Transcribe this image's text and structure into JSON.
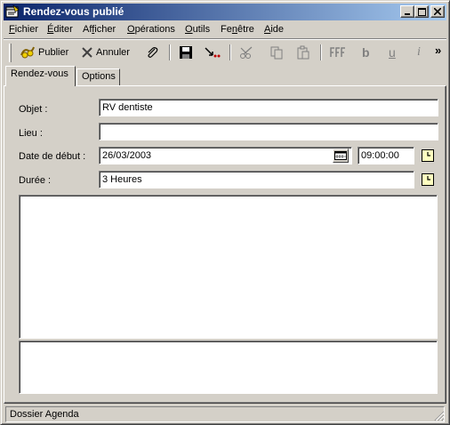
{
  "window": {
    "title": "Rendez-vous publié"
  },
  "menu": {
    "items": [
      {
        "label": "Fichier",
        "accel_index": 0
      },
      {
        "label": "Éditer",
        "accel_index": 0
      },
      {
        "label": "Afficher",
        "accel_index": 2
      },
      {
        "label": "Opérations",
        "accel_index": 0
      },
      {
        "label": "Outils",
        "accel_index": 0
      },
      {
        "label": "Fenêtre",
        "accel_index": 2
      },
      {
        "label": "Aide",
        "accel_index": 0
      }
    ]
  },
  "toolbar": {
    "publish_label": "Publier",
    "cancel_label": "Annuler",
    "attach_icon": "paperclip-icon",
    "save_icon": "floppy-disk-icon",
    "send_icon": "send-arrow-icon",
    "cut_icon": "scissors-icon",
    "copy_icon": "copy-icon",
    "paste_icon": "paste-icon",
    "font_icon": "font-icon",
    "bold_label": "b",
    "underline_label": "u",
    "italic_label": "i",
    "overflow_label": "»"
  },
  "tabs": [
    {
      "label": "Rendez-vous",
      "active": true
    },
    {
      "label": "Options",
      "active": false
    }
  ],
  "form": {
    "subject_label": "Objet :",
    "subject_value": "RV dentiste",
    "location_label": "Lieu :",
    "location_value": "",
    "start_label": "Date de début :",
    "start_date": "26/03/2003",
    "start_time": "09:00:00",
    "duration_label": "Durée :",
    "duration_value": "3 Heures"
  },
  "statusbar": {
    "text": "Dossier Agenda"
  },
  "colors": {
    "title_gradient_start": "#0a246a",
    "title_gradient_end": "#a6caf0",
    "face": "#d4d0c8"
  }
}
